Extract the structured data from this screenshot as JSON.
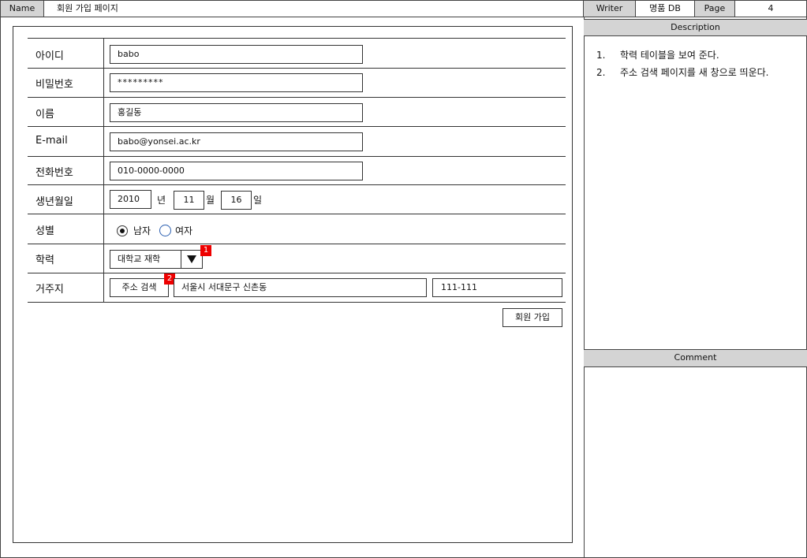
{
  "header": {
    "name_label": "Name",
    "name_value": "회원 가입 페이지",
    "writer_label": "Writer",
    "writer_value": "명품 DB",
    "page_label": "Page",
    "page_value": "4"
  },
  "description": {
    "title": "Description",
    "items": [
      {
        "num": "1.",
        "text": "학력 테이블을 보여 준다."
      },
      {
        "num": "2.",
        "text": "주소 검색 페이지를 새 창으로 띄운다."
      }
    ]
  },
  "comment": {
    "title": "Comment"
  },
  "form": {
    "id": {
      "label": "아이디",
      "value": "babo"
    },
    "password": {
      "label": "비밀번호",
      "value": "*********"
    },
    "name": {
      "label": "이름",
      "value": "홍길동"
    },
    "email": {
      "label": "E-mail",
      "value": "babo@yonsei.ac.kr"
    },
    "phone": {
      "label": "전화번호",
      "value": "010-0000-0000"
    },
    "birth": {
      "label": "생년월일",
      "year": "2010",
      "year_unit": "년",
      "month": "11",
      "month_unit": "월",
      "day": "16",
      "day_unit": "일"
    },
    "gender": {
      "label": "성별",
      "options": [
        {
          "label": "남자",
          "selected": true
        },
        {
          "label": "여자",
          "selected": false
        }
      ]
    },
    "education": {
      "label": "학력",
      "value": "대학교 재학",
      "marker": "1"
    },
    "address": {
      "label": "거주지",
      "search_button": "주소 검색",
      "marker": "2",
      "address_value": "서울시 서대문구 신촌동",
      "zip_value": "111-111"
    },
    "submit_label": "회원 가입"
  },
  "colors": {
    "marker": "#ee0000",
    "header_gray": "#d4d4d4",
    "radio_unselected": "#2b5fb0"
  }
}
